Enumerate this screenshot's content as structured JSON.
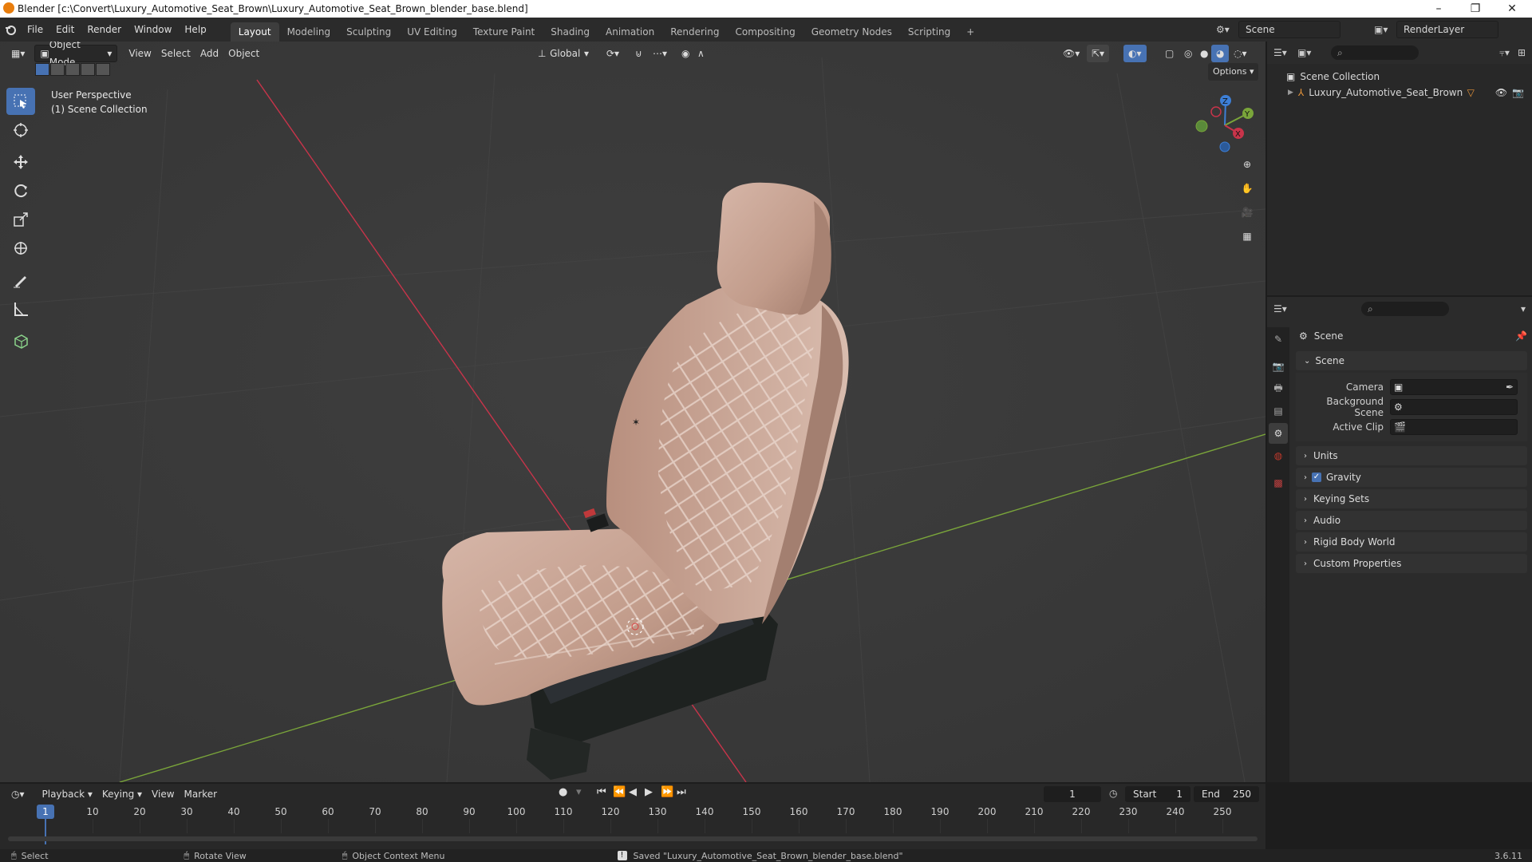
{
  "window": {
    "title": "Blender [c:\\Convert\\Luxury_Automotive_Seat_Brown\\Luxury_Automotive_Seat_Brown_blender_base.blend]",
    "minimize": "–",
    "maximize": "❐",
    "close": "✕"
  },
  "menus": [
    "File",
    "Edit",
    "Render",
    "Window",
    "Help"
  ],
  "workspaces": [
    "Layout",
    "Modeling",
    "Sculpting",
    "UV Editing",
    "Texture Paint",
    "Shading",
    "Animation",
    "Rendering",
    "Compositing",
    "Geometry Nodes",
    "Scripting"
  ],
  "workspace_add": "+",
  "active_workspace": "Layout",
  "scene_selector": {
    "value": "Scene"
  },
  "layer_selector": {
    "value": "RenderLayer"
  },
  "viewport": {
    "mode": "Object Mode",
    "menus": [
      "View",
      "Select",
      "Add",
      "Object"
    ],
    "transform_orientation": "Global",
    "options_label": "Options",
    "perspective_label": "User Perspective",
    "collection_label": "(1) Scene Collection",
    "axis_labels": {
      "z": "Z",
      "y": "Y",
      "x": "X"
    }
  },
  "outliner": {
    "root": "Scene Collection",
    "items": [
      {
        "label": "Luxury_Automotive_Seat_Brown"
      }
    ]
  },
  "properties": {
    "header": "Scene",
    "section": "Scene",
    "fields": [
      {
        "label": "Camera"
      },
      {
        "label": "Background Scene"
      },
      {
        "label": "Active Clip"
      }
    ],
    "panels": [
      {
        "label": "Units",
        "checkbox": false
      },
      {
        "label": "Gravity",
        "checkbox": true
      },
      {
        "label": "Keying Sets",
        "checkbox": false
      },
      {
        "label": "Audio",
        "checkbox": false
      },
      {
        "label": "Rigid Body World",
        "checkbox": false
      },
      {
        "label": "Custom Properties",
        "checkbox": false
      }
    ]
  },
  "timeline": {
    "menus": [
      "Playback",
      "Keying",
      "View",
      "Marker"
    ],
    "current_frame": "1",
    "start_label": "Start",
    "start": "1",
    "end_label": "End",
    "end": "250",
    "ticks": [
      "10",
      "20",
      "30",
      "40",
      "50",
      "60",
      "70",
      "80",
      "90",
      "100",
      "110",
      "120",
      "130",
      "140",
      "150",
      "160",
      "170",
      "180",
      "190",
      "200",
      "210",
      "220",
      "230",
      "240",
      "250"
    ]
  },
  "statusbar": {
    "select": "Select",
    "rotate": "Rotate View",
    "context": "Object Context Menu",
    "message": "Saved \"Luxury_Automotive_Seat_Brown_blender_base.blend\"",
    "version": "3.6.11"
  },
  "colors": {
    "accent": "#4772b3",
    "x_axis": "#c8344a",
    "y_axis": "#7aa53a",
    "z_axis": "#3d7fd6",
    "seat": "#c9a595"
  }
}
